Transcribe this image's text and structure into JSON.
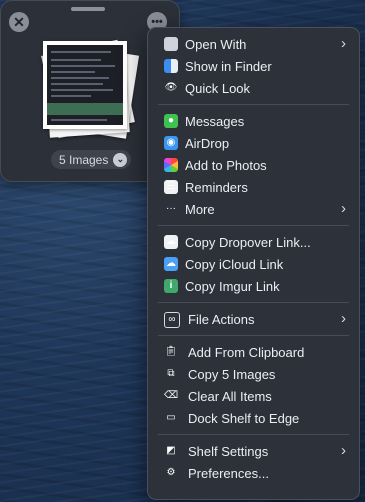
{
  "shelf": {
    "close_icon": "close-icon",
    "more_icon": "ellipsis-icon",
    "count_label": "5 Images",
    "count_icon": "chevron-down-icon"
  },
  "menu": {
    "groups": [
      [
        {
          "label": "Open With",
          "icon": "open-with-icon",
          "submenu": true
        },
        {
          "label": "Show in Finder",
          "icon": "finder-icon",
          "submenu": false
        },
        {
          "label": "Quick Look",
          "icon": "eye-icon",
          "submenu": false
        }
      ],
      [
        {
          "label": "Messages",
          "icon": "messages-icon",
          "submenu": false
        },
        {
          "label": "AirDrop",
          "icon": "airdrop-icon",
          "submenu": false
        },
        {
          "label": "Add to Photos",
          "icon": "photos-icon",
          "submenu": false
        },
        {
          "label": "Reminders",
          "icon": "reminders-icon",
          "submenu": false
        },
        {
          "label": "More",
          "icon": "more-dots-icon",
          "submenu": true
        }
      ],
      [
        {
          "label": "Copy Dropover Link...",
          "icon": "dropover-cloud-icon",
          "submenu": false
        },
        {
          "label": "Copy iCloud Link",
          "icon": "icloud-icon",
          "submenu": false
        },
        {
          "label": "Copy Imgur Link",
          "icon": "imgur-icon",
          "submenu": false
        }
      ],
      [
        {
          "label": "File Actions",
          "icon": "file-actions-icon",
          "submenu": true
        }
      ],
      [
        {
          "label": "Add From Clipboard",
          "icon": "clipboard-icon",
          "submenu": false
        },
        {
          "label": "Copy 5 Images",
          "icon": "copy-icon",
          "submenu": false
        },
        {
          "label": "Clear All Items",
          "icon": "clear-icon",
          "submenu": false
        },
        {
          "label": "Dock Shelf to Edge",
          "icon": "dock-icon",
          "submenu": false
        }
      ],
      [
        {
          "label": "Shelf Settings",
          "icon": "shelf-settings-icon",
          "submenu": true
        },
        {
          "label": "Preferences...",
          "icon": "gear-icon",
          "submenu": false
        }
      ]
    ]
  }
}
